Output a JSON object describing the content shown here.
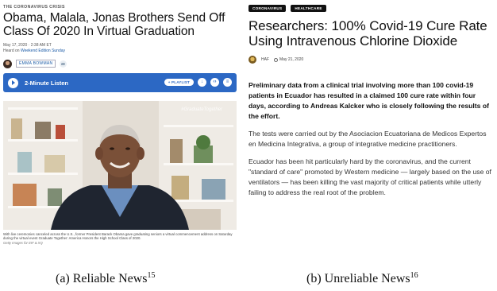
{
  "reliable": {
    "kicker": "THE CORONAVIRUS CRISIS",
    "title": "Obama, Malala, Jonas Brothers Send Off Class Of 2020 In Virtual Graduation",
    "date": "May 17, 2020 · 2:38 AM ET",
    "heard_on_prefix": "Heard on ",
    "heard_on_link": "Weekend Edition Sunday",
    "author": "EMMA BOWMAN",
    "listen_label": "2-Minute Listen",
    "playlist_label": "+ PLAYLIST",
    "photo_watermark": "#GraduateTogether",
    "photo_caption": "With live ceremonies canceled across the U.S., former President Barack Obama gave graduating seniors a virtual commencement address on Saturday during the virtual event Graduate Together: America Honors the High School Class of 2020.",
    "photo_credit": "Getty Images for EIF & XQ"
  },
  "unreliable": {
    "tags": [
      "CORONAVIRUS",
      "HEALTHCARE"
    ],
    "title": "Researchers: 100% Covid-19 Cure Rate Using Intravenous Chlorine Dioxide",
    "author": "HAF",
    "date": "May 21, 2020",
    "lead": "Preliminary data from a clinical trial involving more than 100 covid-19 patients in Ecuador has resulted in a claimed 100 cure rate within four days, according to Andreas Kalcker who is closely following the results of the effort.",
    "para1": "The tests were carried out by the Asociacion Ecuatoriana de Medicos Expertos en Medicina Integrativa, a group of integrative medicine practitioners.",
    "para2": "Ecuador has been hit particularly hard by the coronavirus, and the current \"standard of care\" promoted by Western medicine — largely based on the use of ventilators — has been killing the vast majority of critical patients while utterly failing to address the real root of the problem."
  },
  "captions": {
    "a_label": "(a)  Reliable News",
    "a_note": "15",
    "b_label": "(b)  Unreliable News",
    "b_note": "16"
  },
  "colors": {
    "link_blue": "#1a5aa6",
    "listen_bar": "#2c68c4",
    "tag_black": "#111111"
  }
}
